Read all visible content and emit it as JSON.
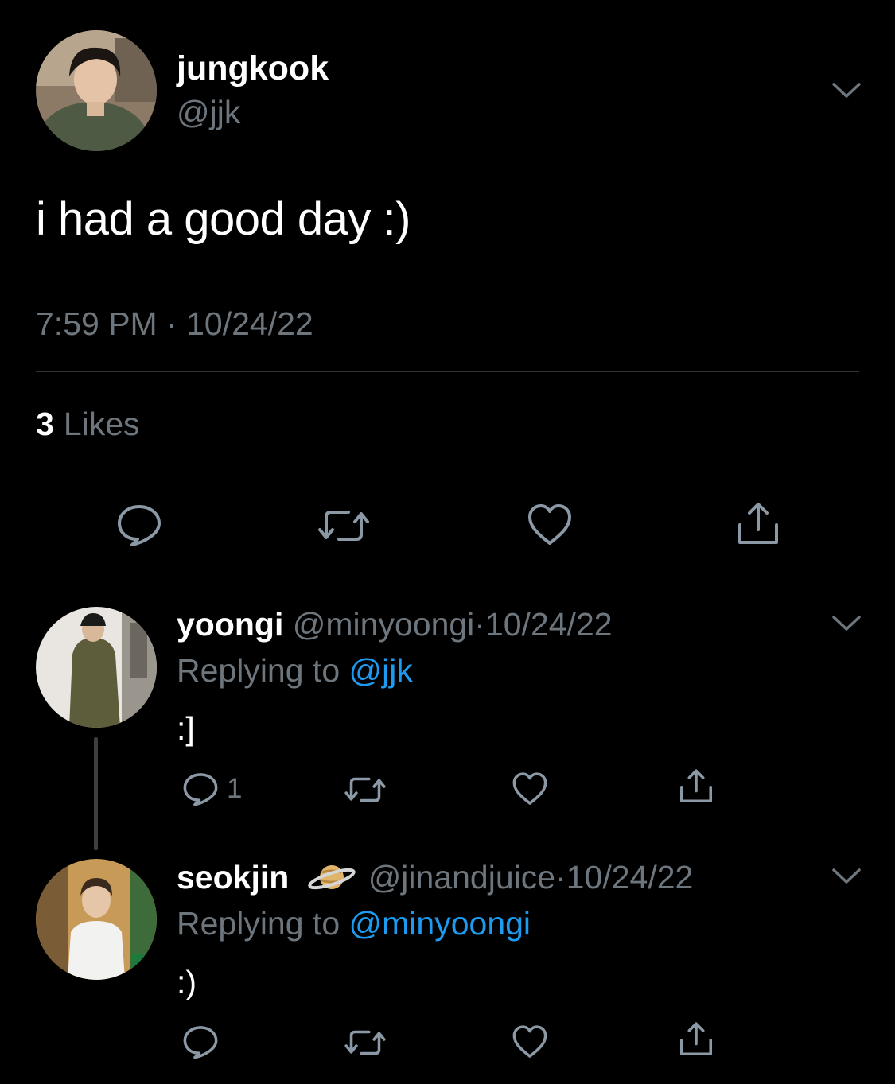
{
  "tweet": {
    "display_name": "jungkook",
    "handle": "@jjk",
    "text": "i had a good day :)",
    "timestamp": "7:59 PM · 10/24/22",
    "likes_count": "3",
    "likes_label": "Likes"
  },
  "replies": [
    {
      "display_name": "yoongi",
      "handle": "@minyoongi",
      "dot": "·",
      "date": "10/24/22",
      "replying_prefix": "Replying to",
      "replying_to": "@jjk",
      "text": ":]",
      "reply_count": "1"
    },
    {
      "display_name": "seokjin",
      "badge_icon": "planet-emoji",
      "handle": "@jinandjuice",
      "dot": "·",
      "date": "10/24/22",
      "replying_prefix": "Replying to",
      "replying_to": "@minyoongi",
      "text": ":)",
      "reply_count": ""
    }
  ],
  "colors": {
    "background": "#000000",
    "text_primary": "#ffffff",
    "text_secondary": "#6e767d",
    "accent": "#1d9bf0",
    "divider": "#2f3336"
  }
}
